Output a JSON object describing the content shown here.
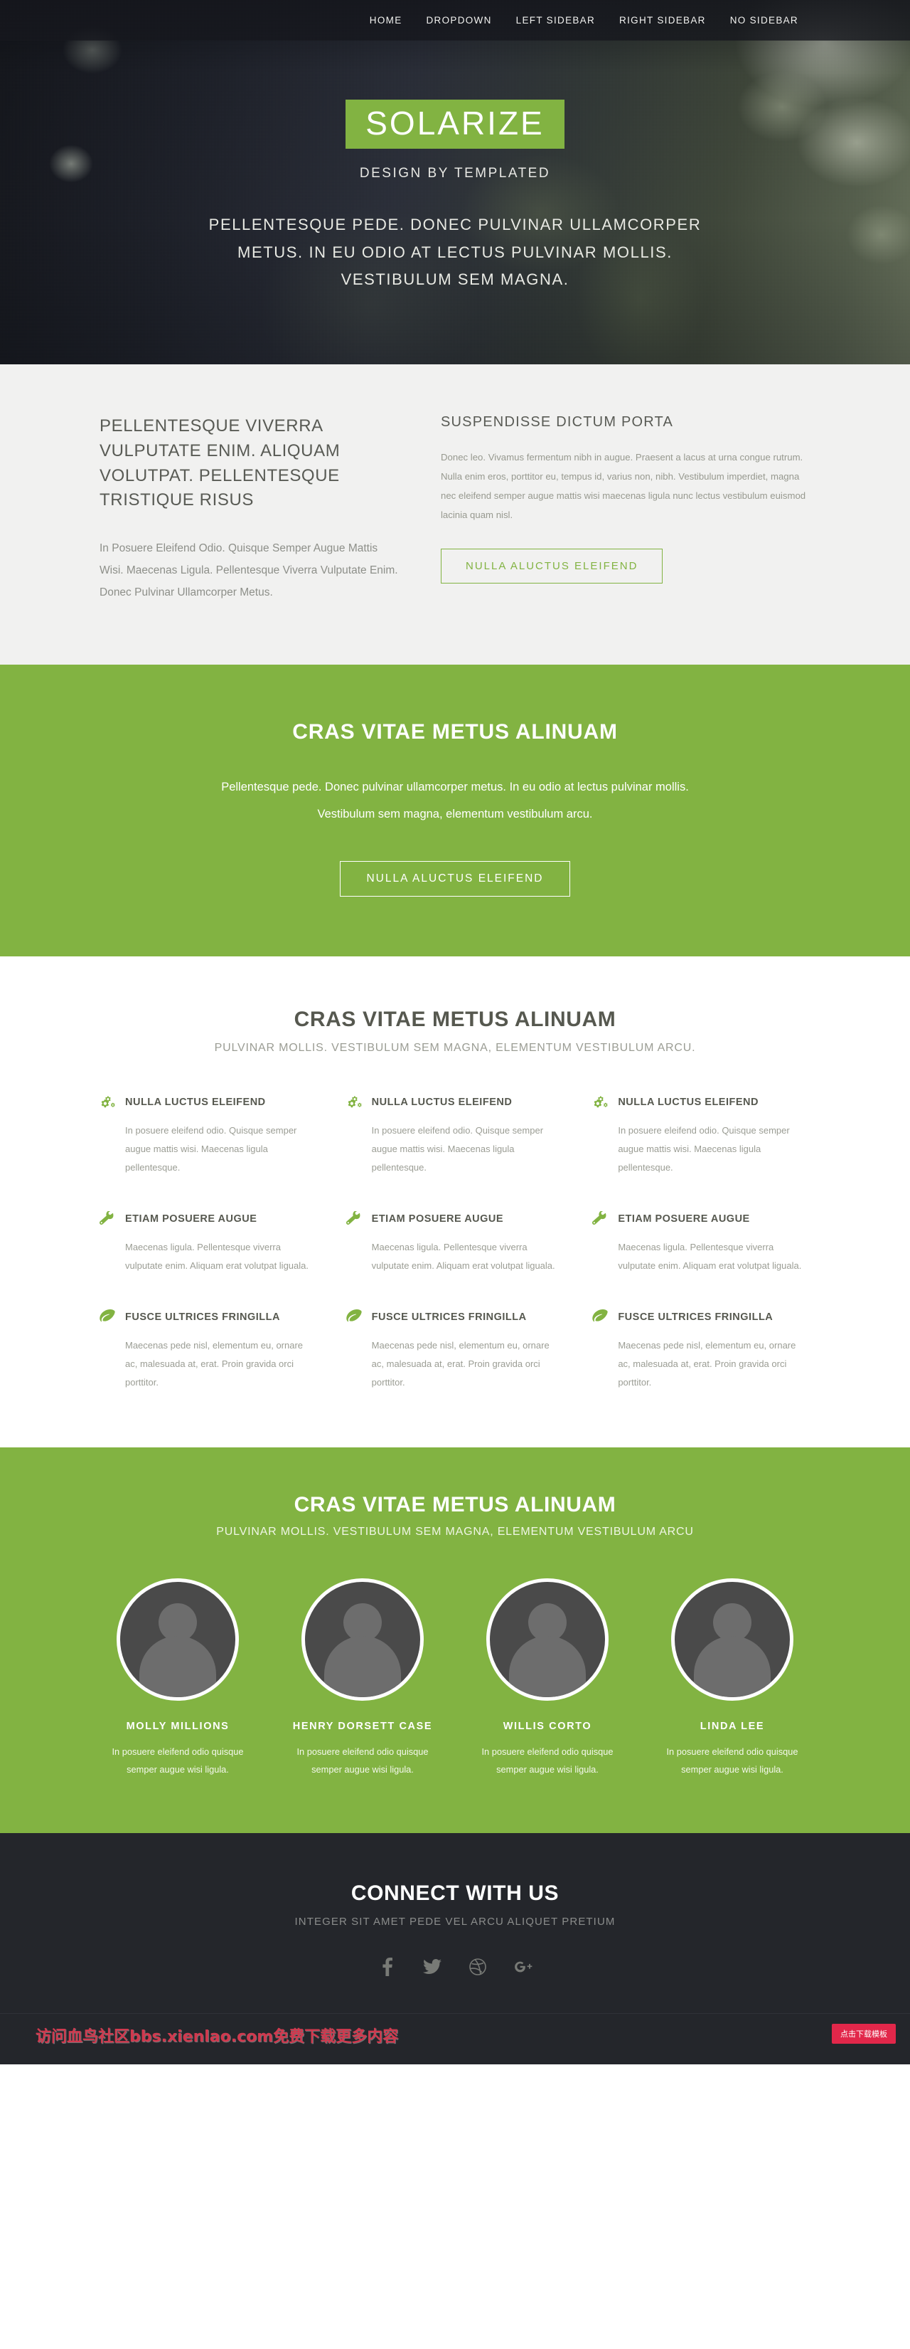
{
  "nav": {
    "items": [
      {
        "label": "HOME"
      },
      {
        "label": "DROPDOWN"
      },
      {
        "label": "LEFT SIDEBAR"
      },
      {
        "label": "RIGHT SIDEBAR"
      },
      {
        "label": "NO SIDEBAR"
      }
    ]
  },
  "hero": {
    "title": "SOLARIZE",
    "subtitle": "DESIGN BY TEMPLATED",
    "lead": "PELLENTESQUE PEDE. DONEC PULVINAR ULLAMCORPER METUS. IN EU ODIO AT LECTUS PULVINAR MOLLIS. VESTIBULUM SEM MAGNA."
  },
  "intro": {
    "left_heading": "PELLENTESQUE VIVERRA VULPUTATE ENIM. ALIQUAM VOLUTPAT. PELLENTESQUE TRISTIQUE RISUS",
    "left_paragraph": "In Posuere Eleifend Odio. Quisque Semper Augue Mattis Wisi. Maecenas Ligula. Pellentesque Viverra Vulputate Enim. Donec Pulvinar Ullamcorper Metus.",
    "right_heading": "SUSPENDISSE DICTUM PORTA",
    "right_paragraph": "Donec leo. Vivamus fermentum nibh in augue. Praesent a lacus at urna congue rutrum. Nulla enim eros, porttitor eu, tempus id, varius non, nibh. Vestibulum imperdiet, magna nec eleifend semper augue mattis wisi maecenas ligula nunc lectus vestibulum euismod lacinia quam nisl.",
    "button_label": "NULLA ALUCTUS ELEIFEND"
  },
  "cta": {
    "heading": "CRAS VITAE METUS ALINUAM",
    "paragraph": "Pellentesque pede. Donec pulvinar ullamcorper metus. In eu odio at lectus pulvinar mollis. Vestibulum sem magna, elementum vestibulum arcu.",
    "button_label": "NULLA ALUCTUS ELEIFEND"
  },
  "features": {
    "heading": "CRAS VITAE METUS ALINUAM",
    "subheading": "PULVINAR MOLLIS. VESTIBULUM SEM MAGNA, ELEMENTUM VESTIBULUM ARCU.",
    "items": [
      {
        "icon": "cogs-icon",
        "title": "NULLA LUCTUS ELEIFEND",
        "body": "In posuere eleifend odio. Quisque semper augue mattis wisi. Maecenas ligula pellentesque."
      },
      {
        "icon": "cogs-icon",
        "title": "NULLA LUCTUS ELEIFEND",
        "body": "In posuere eleifend odio. Quisque semper augue mattis wisi. Maecenas ligula pellentesque."
      },
      {
        "icon": "cogs-icon",
        "title": "NULLA LUCTUS ELEIFEND",
        "body": "In posuere eleifend odio. Quisque semper augue mattis wisi. Maecenas ligula pellentesque."
      },
      {
        "icon": "wrench-icon",
        "title": "ETIAM POSUERE AUGUE",
        "body": "Maecenas ligula. Pellentesque viverra vulputate enim. Aliquam erat volutpat liguala."
      },
      {
        "icon": "wrench-icon",
        "title": "ETIAM POSUERE AUGUE",
        "body": "Maecenas ligula. Pellentesque viverra vulputate enim. Aliquam erat volutpat liguala."
      },
      {
        "icon": "wrench-icon",
        "title": "ETIAM POSUERE AUGUE",
        "body": "Maecenas ligula. Pellentesque viverra vulputate enim. Aliquam erat volutpat liguala."
      },
      {
        "icon": "leaf-icon",
        "title": "FUSCE ULTRICES FRINGILLA",
        "body": "Maecenas pede nisl, elementum eu, ornare ac, malesuada at, erat. Proin gravida orci porttitor."
      },
      {
        "icon": "leaf-icon",
        "title": "FUSCE ULTRICES FRINGILLA",
        "body": "Maecenas pede nisl, elementum eu, ornare ac, malesuada at, erat. Proin gravida orci porttitor."
      },
      {
        "icon": "leaf-icon",
        "title": "FUSCE ULTRICES FRINGILLA",
        "body": "Maecenas pede nisl, elementum eu, ornare ac, malesuada at, erat. Proin gravida orci porttitor."
      }
    ]
  },
  "team": {
    "heading": "CRAS VITAE METUS ALINUAM",
    "subheading": "PULVINAR MOLLIS. VESTIBULUM SEM MAGNA, ELEMENTUM VESTIBULUM ARCU",
    "members": [
      {
        "name": "MOLLY MILLIONS",
        "desc": "In posuere eleifend odio quisque semper augue wisi ligula.",
        "avatar": "person-avatar"
      },
      {
        "name": "HENRY DORSETT CASE",
        "desc": "In posuere eleifend odio quisque semper augue wisi ligula.",
        "avatar": "person-avatar"
      },
      {
        "name": "WILLIS CORTO",
        "desc": "In posuere eleifend odio quisque semper augue wisi ligula.",
        "avatar": "person-avatar"
      },
      {
        "name": "LINDA LEE",
        "desc": "In posuere eleifend odio quisque semper augue wisi ligula.",
        "avatar": "person-avatar"
      }
    ]
  },
  "footer": {
    "heading": "CONNECT WITH US",
    "subheading": "INTEGER SIT AMET PEDE VEL ARCU ALIQUET PRETIUM",
    "socials": [
      {
        "name": "facebook-icon"
      },
      {
        "name": "twitter-icon"
      },
      {
        "name": "dribbble-icon"
      },
      {
        "name": "google-plus-icon"
      }
    ],
    "watermark": "访问血鸟社区bbs.xienlao.com免费下载更多内容",
    "download_badge": "点击下载模板"
  },
  "colors": {
    "accent_green": "#82b342",
    "dark": "#24262b",
    "grey_bg": "#f1f1f0",
    "text_dark": "#56584f",
    "text_muted": "#9b9d94",
    "watermark_red": "#d0394e"
  }
}
